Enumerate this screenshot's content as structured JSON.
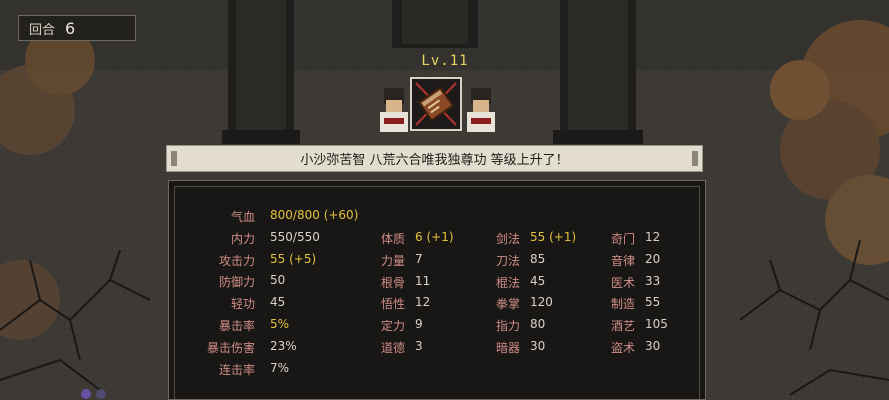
{
  "hud": {
    "round_label": "回合",
    "round_value": "6"
  },
  "level": {
    "label": "Lv.11"
  },
  "banner": {
    "message": "小沙弥苦智 八荒六合唯我独尊功 等级上升了！"
  },
  "stats": {
    "col1": [
      {
        "label": "气血",
        "value": "800/800",
        "bonus": "(+60)",
        "highlight": true
      },
      {
        "label": "内力",
        "value": "550/550",
        "bonus": "",
        "highlight": false
      },
      {
        "label": "攻击力",
        "value": "55",
        "bonus": "(+5)",
        "highlight": true
      },
      {
        "label": "防御力",
        "value": "50",
        "bonus": "",
        "highlight": false
      },
      {
        "label": "轻功",
        "value": "45",
        "bonus": "",
        "highlight": false
      },
      {
        "label": "暴击率",
        "value": "5%",
        "bonus": "",
        "highlight": true
      },
      {
        "label": "暴击伤害",
        "value": "23%",
        "bonus": "",
        "highlight": false
      },
      {
        "label": "连击率",
        "value": "7%",
        "bonus": "",
        "highlight": false
      }
    ],
    "col2": [
      {
        "label": "体质",
        "value": "6",
        "bonus": "(+1)",
        "highlight": true
      },
      {
        "label": "力量",
        "value": "7",
        "bonus": "",
        "highlight": false
      },
      {
        "label": "根骨",
        "value": "11",
        "bonus": "",
        "highlight": false
      },
      {
        "label": "悟性",
        "value": "12",
        "bonus": "",
        "highlight": false
      },
      {
        "label": "定力",
        "value": "9",
        "bonus": "",
        "highlight": false
      },
      {
        "label": "道德",
        "value": "3",
        "bonus": "",
        "highlight": false
      }
    ],
    "col3": [
      {
        "label": "剑法",
        "value": "55",
        "bonus": "(+1)",
        "highlight": true
      },
      {
        "label": "刀法",
        "value": "85",
        "bonus": "",
        "highlight": false
      },
      {
        "label": "棍法",
        "value": "45",
        "bonus": "",
        "highlight": false
      },
      {
        "label": "拳掌",
        "value": "120",
        "bonus": "",
        "highlight": false
      },
      {
        "label": "指力",
        "value": "80",
        "bonus": "",
        "highlight": false
      },
      {
        "label": "暗器",
        "value": "30",
        "bonus": "",
        "highlight": false
      }
    ],
    "col4": [
      {
        "label": "奇门",
        "value": "12",
        "bonus": "",
        "highlight": false
      },
      {
        "label": "音律",
        "value": "20",
        "bonus": "",
        "highlight": false
      },
      {
        "label": "医术",
        "value": "33",
        "bonus": "",
        "highlight": false
      },
      {
        "label": "制造",
        "value": "55",
        "bonus": "",
        "highlight": false
      },
      {
        "label": "酒艺",
        "value": "105",
        "bonus": "",
        "highlight": false
      },
      {
        "label": "盗术",
        "value": "30",
        "bonus": "",
        "highlight": false
      }
    ]
  }
}
